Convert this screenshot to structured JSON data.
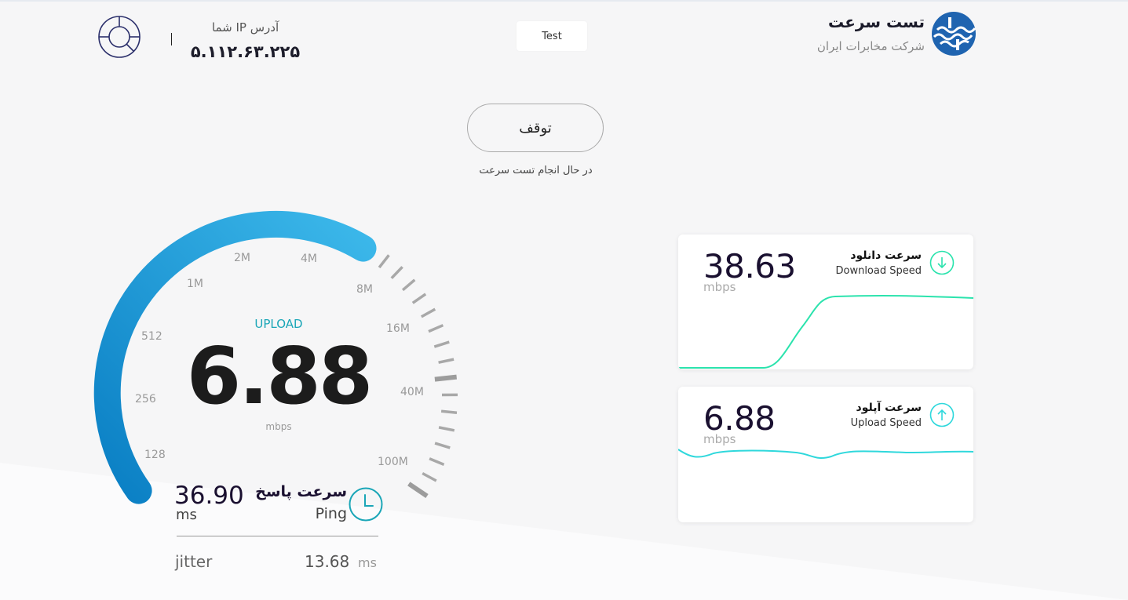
{
  "header": {
    "brand_title": "تست سرعت",
    "brand_subtitle": "شرکت مخابرات ایران",
    "test_button": "Test",
    "ip_label": "آدرس IP شما",
    "ip_value": "۵.۱۱۲.۶۳.۲۲۵"
  },
  "controls": {
    "stop_label": "توقف",
    "status": "در حال انجام تست سرعت"
  },
  "gauge": {
    "mode": "UPLOAD",
    "value": "6.88",
    "unit": "mbps",
    "scale": [
      "128",
      "256",
      "512",
      "1M",
      "2M",
      "4M",
      "8M",
      "16M",
      "40M",
      "100M"
    ]
  },
  "ping": {
    "value": "36.90",
    "unit": "ms",
    "title": "سرعت پاسخ",
    "subtitle": "Ping",
    "jitter_label": "jitter",
    "jitter_value": "13.68",
    "jitter_unit": "ms"
  },
  "download": {
    "title": "سرعت دانلود",
    "subtitle": "Download Speed",
    "value": "38.63",
    "unit": "mbps"
  },
  "upload": {
    "title": "سرعت آپلود",
    "subtitle": "Upload Speed",
    "value": "6.88",
    "unit": "mbps"
  },
  "colors": {
    "gauge_start": "#0a7fc4",
    "gauge_end": "#3cb8ea",
    "accent_teal": "#1aa6b7",
    "download_line": "#2be3ad",
    "upload_line": "#2fd8dc",
    "brand_blue": "#1f64b0"
  }
}
